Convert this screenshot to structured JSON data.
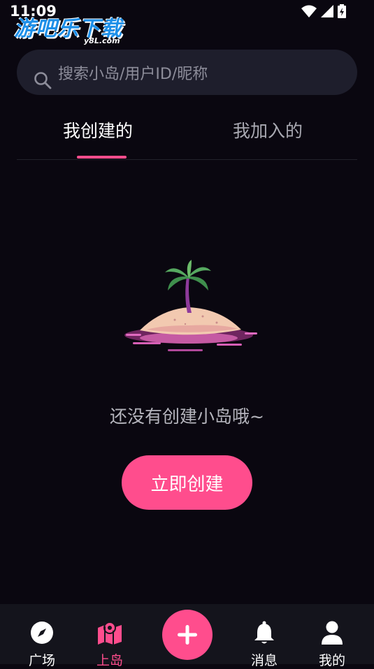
{
  "status_bar": {
    "time": "11:09"
  },
  "watermark": {
    "main": "游吧乐下载",
    "sub": "y8L.com"
  },
  "search": {
    "placeholder": "搜索小岛/用户ID/昵称"
  },
  "tabs": [
    {
      "label": "我创建的",
      "active": true
    },
    {
      "label": "我加入的",
      "active": false
    }
  ],
  "empty_state": {
    "message": "还没有创建小岛哦~",
    "button_label": "立即创建"
  },
  "bottom_nav": {
    "items": [
      {
        "label": "广场",
        "icon": "compass-icon"
      },
      {
        "label": "上岛",
        "icon": "map-icon",
        "active": true
      },
      {
        "label": "",
        "icon": "plus-icon"
      },
      {
        "label": "消息",
        "icon": "bell-icon"
      },
      {
        "label": "我的",
        "icon": "user-icon"
      }
    ]
  },
  "colors": {
    "accent": "#ff4d8d",
    "background": "#0a0710",
    "nav_background": "#14141c"
  }
}
